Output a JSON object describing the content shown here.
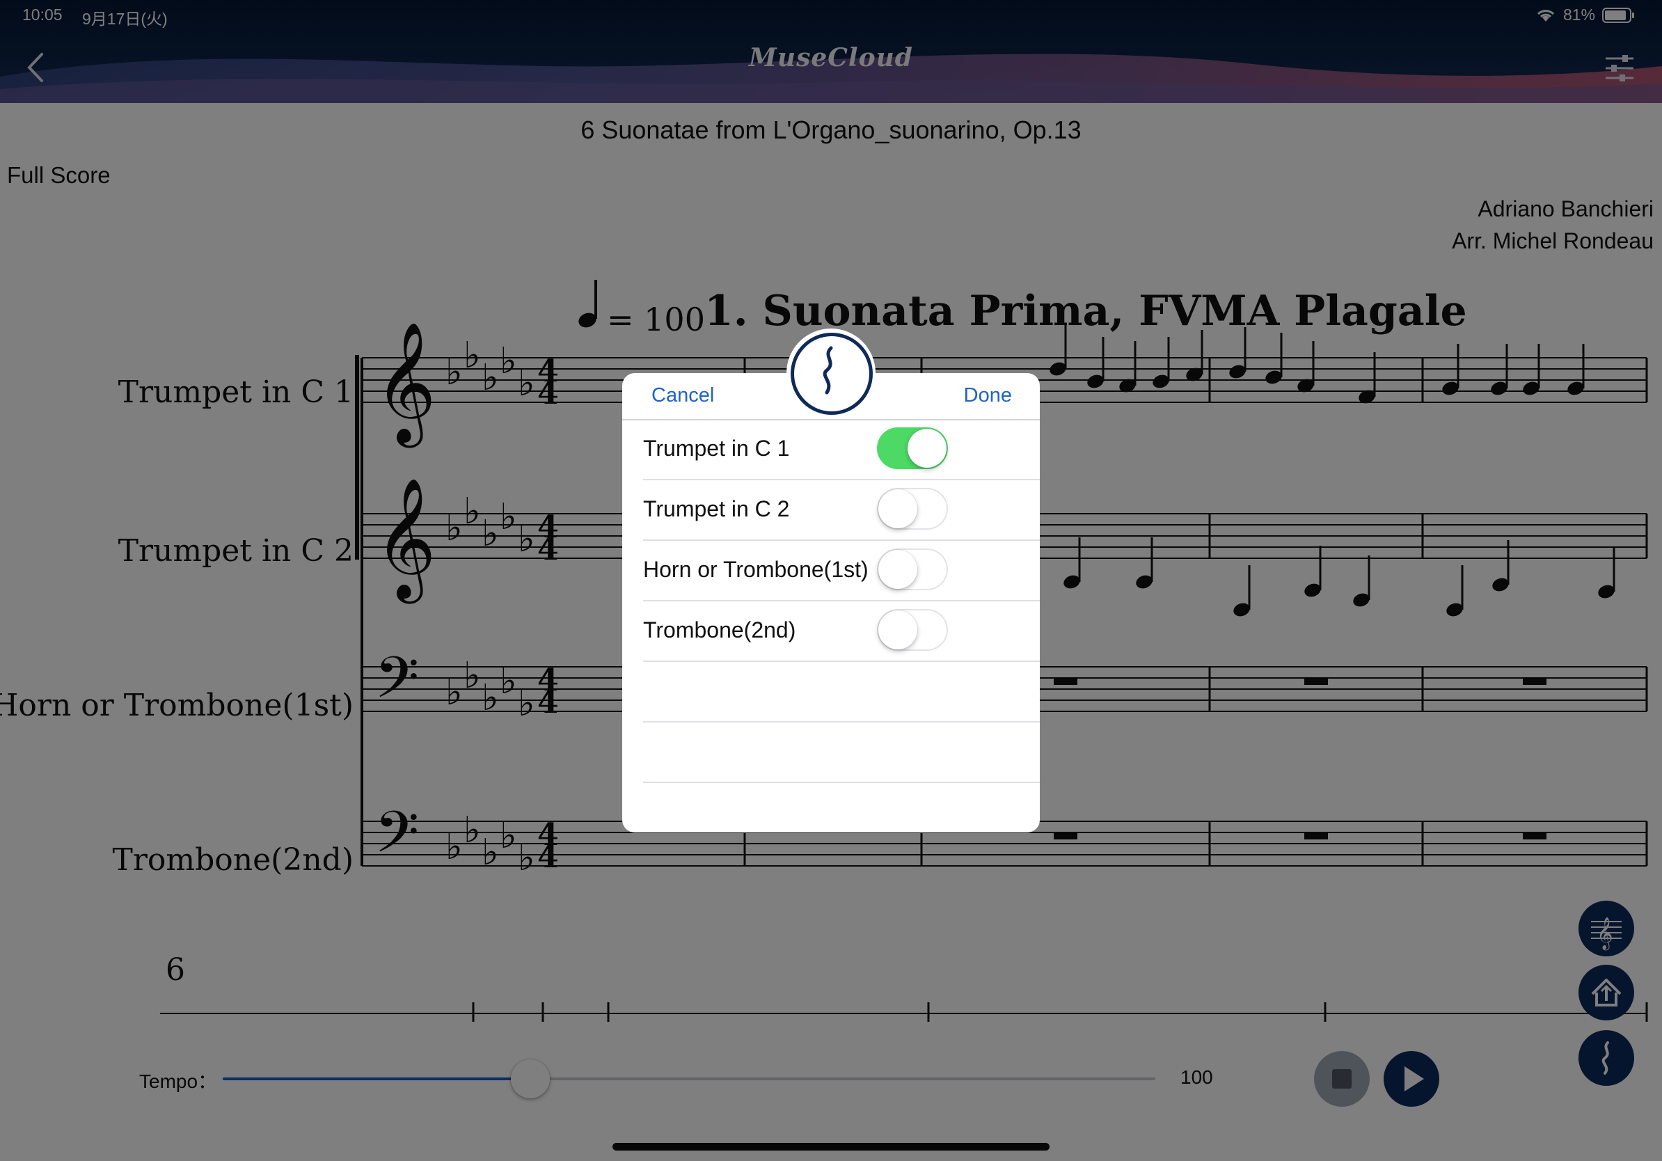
{
  "status_bar": {
    "time": "10:05",
    "date": "9月17日(火)",
    "battery": "81%"
  },
  "header": {
    "app_name": "MuseCloud",
    "back_icon": "chevron-left-icon",
    "settings_icon": "sliders-icon"
  },
  "score": {
    "title": "6 Suonatae from L'Organo_suonarino, Op.13",
    "subtitle": "Full Score",
    "composer": "Adriano Banchieri",
    "arranger": "Arr. Michel Rondeau",
    "movement": "1. Suonata Prima, FVMA Plagale",
    "tempo_marking": "= 100",
    "parts": [
      "Trumpet in C 1",
      "Trumpet in C 2",
      "Horn or Trombone(1st)",
      "Trombone(2nd)"
    ],
    "time_signature": "4/4",
    "second_system_measure": "6"
  },
  "dialog": {
    "cancel_label": "Cancel",
    "done_label": "Done",
    "icon": "instrument-selection-icon",
    "instruments": [
      {
        "name": "Trumpet in C 1",
        "enabled": true
      },
      {
        "name": "Trumpet in C 2",
        "enabled": false
      },
      {
        "name": "Horn or Trombone(1st)",
        "enabled": false
      },
      {
        "name": "Trombone(2nd)",
        "enabled": false
      }
    ]
  },
  "player": {
    "tempo_label": "Tempo：",
    "tempo_value": "100",
    "tempo_slider_fraction": 0.33,
    "stop_icon": "stop-icon",
    "play_icon": "play-icon"
  },
  "side_buttons": [
    "score-view-icon",
    "export-icon",
    "instrument-selection-icon"
  ],
  "colors": {
    "accent_blue": "#1f63c6",
    "navy": "#0b2a5a",
    "toggle_on": "#4cd964",
    "slider_fill": "#1560c8"
  }
}
